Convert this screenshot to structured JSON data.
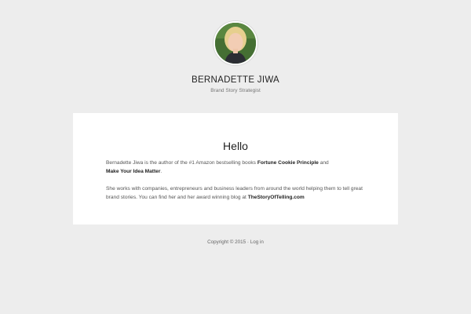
{
  "site": {
    "title": "BERNADETTE JIWA",
    "description": "Brand Story Strategist"
  },
  "post": {
    "title": "Hello",
    "p1": {
      "text_before": "Bernadette Jiwa is the author of the #1 Amazon bestselling books ",
      "link1": "Fortune Cookie Principle",
      "text_middle": " and",
      "link2": "Make Your Idea Matter",
      "text_after": "."
    },
    "p2": {
      "text_line1": "She works with companies, entrepreneurs and business leaders from around the world helping them to tell great",
      "text_line2": "brand stories. You can find her and her award winning blog at ",
      "link": "TheStoryOfTelling.com"
    }
  },
  "footer": {
    "copyright": "Copyright © 2015 · ",
    "login": "Log in"
  }
}
